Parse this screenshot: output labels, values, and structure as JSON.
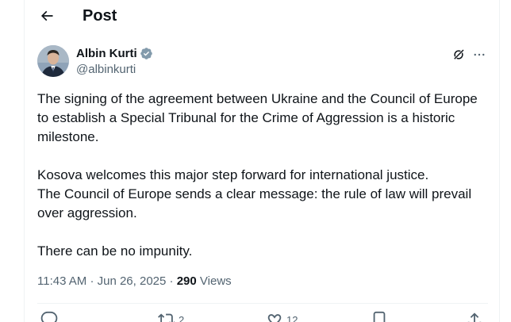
{
  "header": {
    "title": "Post"
  },
  "author": {
    "name": "Albin Kurti",
    "handle": "@albinkurti"
  },
  "tweet": {
    "paragraphs": [
      [
        "The signing of the agreement between Ukraine and the Council of Europe to establish a Special Tribunal for the Crime of Aggression is a historic milestone."
      ],
      [
        "Kosova welcomes this major step forward for international justice.",
        "The Council of Europe sends a clear message: the rule of law will prevail over aggression."
      ],
      [
        "There can be no impunity."
      ]
    ],
    "p1": "The signing of the agreement between Ukraine and the Council of Europe to establish a Special Tribunal for the Crime of Aggression is a historic milestone.",
    "p2a": "Kosova welcomes this major step forward for international justice.",
    "p2b": "The Council of Europe sends a clear message: the rule of law will prevail over aggression.",
    "p3": "There can be no impunity."
  },
  "meta": {
    "time": "11:43 AM",
    "separator": "·",
    "date": "Jun 26, 2025",
    "views_count": "290",
    "views_label": "Views"
  },
  "actions": {
    "reposts": "2",
    "likes": "12"
  },
  "icons": {
    "back": "arrow-left-icon",
    "verified": "verified-badge-icon",
    "grok": "grok-icon",
    "more": "more-horizontal-icon",
    "reply": "reply-icon",
    "repost": "repost-icon",
    "like": "heart-icon",
    "bookmark": "bookmark-icon",
    "share": "share-icon"
  },
  "colors": {
    "text_primary": "#0f1419",
    "text_secondary": "#536471",
    "verified_badge": "#829aab",
    "divider": "#eff3f4"
  }
}
